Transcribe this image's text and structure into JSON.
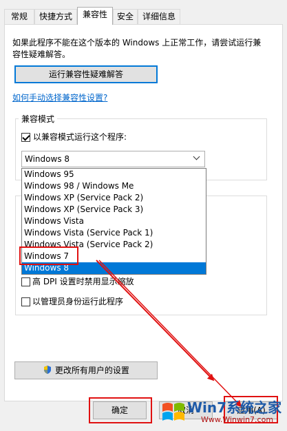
{
  "tabs": [
    {
      "label": "常规"
    },
    {
      "label": "快捷方式"
    },
    {
      "label": "兼容性"
    },
    {
      "label": "安全"
    },
    {
      "label": "详细信息"
    }
  ],
  "intro_text_line1": "如果此程序不能在这个版本的 Windows 上正常工作，请尝试运行兼",
  "intro_text_line2": "容性疑难解答。",
  "troubleshooter_button": "运行兼容性疑难解答",
  "manual_link": "如何手动选择兼容性设置?",
  "compat_group_title": "兼容模式",
  "compat_checkbox_label": "以兼容模式运行这个程序:",
  "compat_combo_value": "Windows 8",
  "dropdown_options": [
    "Windows 95",
    "Windows 98 / Windows Me",
    "Windows XP (Service Pack 2)",
    "Windows XP (Service Pack 3)",
    "Windows Vista",
    "Windows Vista (Service Pack 1)",
    "Windows Vista (Service Pack 2)",
    "Windows 7",
    "Windows 8"
  ],
  "dpi_checkbox_label": "高 DPI 设置时禁用显示缩放",
  "admin_checkbox_label": "以管理员身份运行此程序",
  "change_all_users_button": "更改所有用户的设置",
  "ok_button": "确定",
  "cancel_button": "取消",
  "apply_button": "应用(A)",
  "watermark_text": "Win7系统之家",
  "watermark_url": "Www.Winwin7.com"
}
